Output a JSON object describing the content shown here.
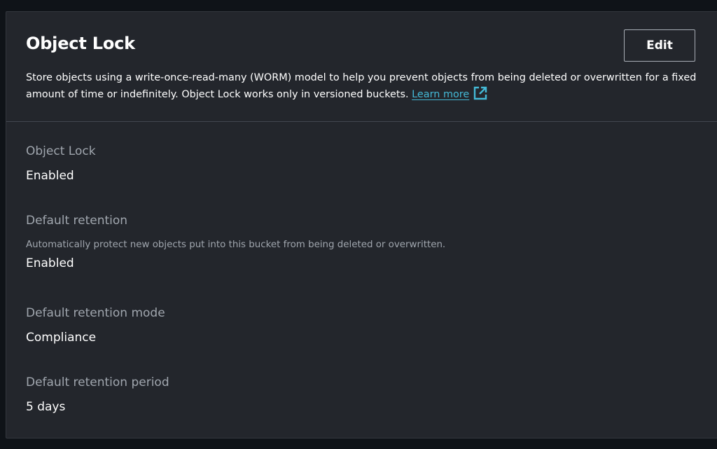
{
  "panel": {
    "title": "Object Lock",
    "edit_label": "Edit",
    "description": "Store objects using a write-once-read-many (WORM) model to help you prevent objects from being deleted or overwritten for a fixed amount of time or indefinitely. Object Lock works only in versioned buckets.",
    "learn_more_label": "Learn more",
    "external_icon": "external-link-icon"
  },
  "fields": [
    {
      "label": "Object Lock",
      "value": "Enabled"
    },
    {
      "label": "Default retention",
      "hint": "Automatically protect new objects put into this bucket from being deleted or overwritten.",
      "value": "Enabled"
    },
    {
      "label": "Default retention mode",
      "value": "Compliance"
    },
    {
      "label": "Default retention period",
      "value": "5 days"
    }
  ],
  "colors": {
    "page_background": "#0f1318",
    "panel_background": "#23262c",
    "link": "#44b9d6",
    "label_text": "#a0a6ae",
    "value_text": "#ffffff"
  }
}
